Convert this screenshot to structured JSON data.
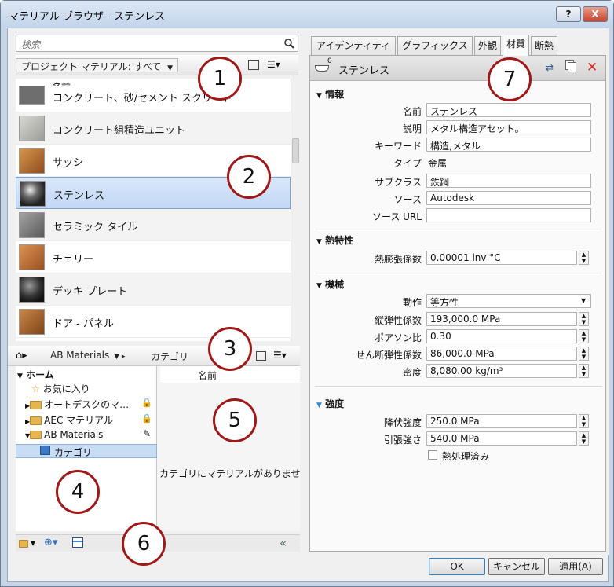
{
  "window": {
    "title": "マテリアル ブラウザ - ステンレス",
    "help_label": "?",
    "close_label": "X"
  },
  "left": {
    "search_placeholder": "検索",
    "project_dropdown": "プロジェクト マテリアル: すべて",
    "list_header": "名前",
    "items": [
      {
        "label": "コンクリート、砂/セメント スクリード",
        "color": "#6e6e6e"
      },
      {
        "label": "コンクリート組積造ユニット",
        "color": "#a8a8a4"
      },
      {
        "label": "サッシ",
        "color": "#b06a2a"
      },
      {
        "label": "ステンレス",
        "color": "#3a3a3a"
      },
      {
        "label": "セラミック タイル",
        "color": "#7d7d7d"
      },
      {
        "label": "チェリー",
        "color": "#b86a30"
      },
      {
        "label": "デッキ プレート",
        "color": "#2f2f2f"
      },
      {
        "label": "ドア - パネル",
        "color": "#a86a34"
      }
    ],
    "lib_breadcrumb": [
      "AB Materials",
      "カテゴリ"
    ],
    "tree": [
      {
        "label": "ホーム"
      },
      {
        "label": "お気に入り"
      },
      {
        "label": "オートデスクのマ…"
      },
      {
        "label": "AEC マテリアル"
      },
      {
        "label": "AB Materials"
      },
      {
        "label": "カテゴリ"
      }
    ],
    "content_header": "名前",
    "empty_message": "カテゴリにマテリアルがありませ",
    "collapse_label": "«"
  },
  "right": {
    "tabs": [
      "アイデンティティ",
      "グラフィックス",
      "外観",
      "材質",
      "断熱"
    ],
    "asset_name": "ステンレス",
    "asset_count": "0",
    "sections": {
      "info": {
        "title": "情報",
        "fields": [
          {
            "label": "名前",
            "value": "ステンレス"
          },
          {
            "label": "説明",
            "value": "メタル構造アセット。"
          },
          {
            "label": "キーワード",
            "value": "構造,メタル"
          },
          {
            "label": "タイプ",
            "value": "金属"
          },
          {
            "label": "サブクラス",
            "value": "鉄鋼"
          },
          {
            "label": "ソース",
            "value": "Autodesk"
          },
          {
            "label": "ソース URL",
            "value": ""
          }
        ]
      },
      "thermal": {
        "title": "熱特性",
        "fields": [
          {
            "label": "熱膨張係数",
            "value": "0.00001 inv °C"
          }
        ]
      },
      "mechanical": {
        "title": "機械",
        "fields": [
          {
            "label": "動作",
            "value": "等方性"
          },
          {
            "label": "縦弾性係数",
            "value": "193,000.0 MPa"
          },
          {
            "label": "ポアソン比",
            "value": "0.30"
          },
          {
            "label": "せん断弾性係数",
            "value": "86,000.0 MPa"
          },
          {
            "label": "密度",
            "value": "8,080.00 kg/m³"
          }
        ]
      },
      "strength": {
        "title": "強度",
        "fields": [
          {
            "label": "降伏強度",
            "value": "250.0 MPa"
          },
          {
            "label": "引張強さ",
            "value": "540.0 MPa"
          }
        ],
        "checkbox_label": "熱処理済み"
      }
    }
  },
  "buttons": {
    "ok": "OK",
    "cancel": "キャンセル",
    "apply": "適用(A)"
  },
  "callouts": [
    "1",
    "2",
    "3",
    "4",
    "5",
    "6",
    "7"
  ]
}
